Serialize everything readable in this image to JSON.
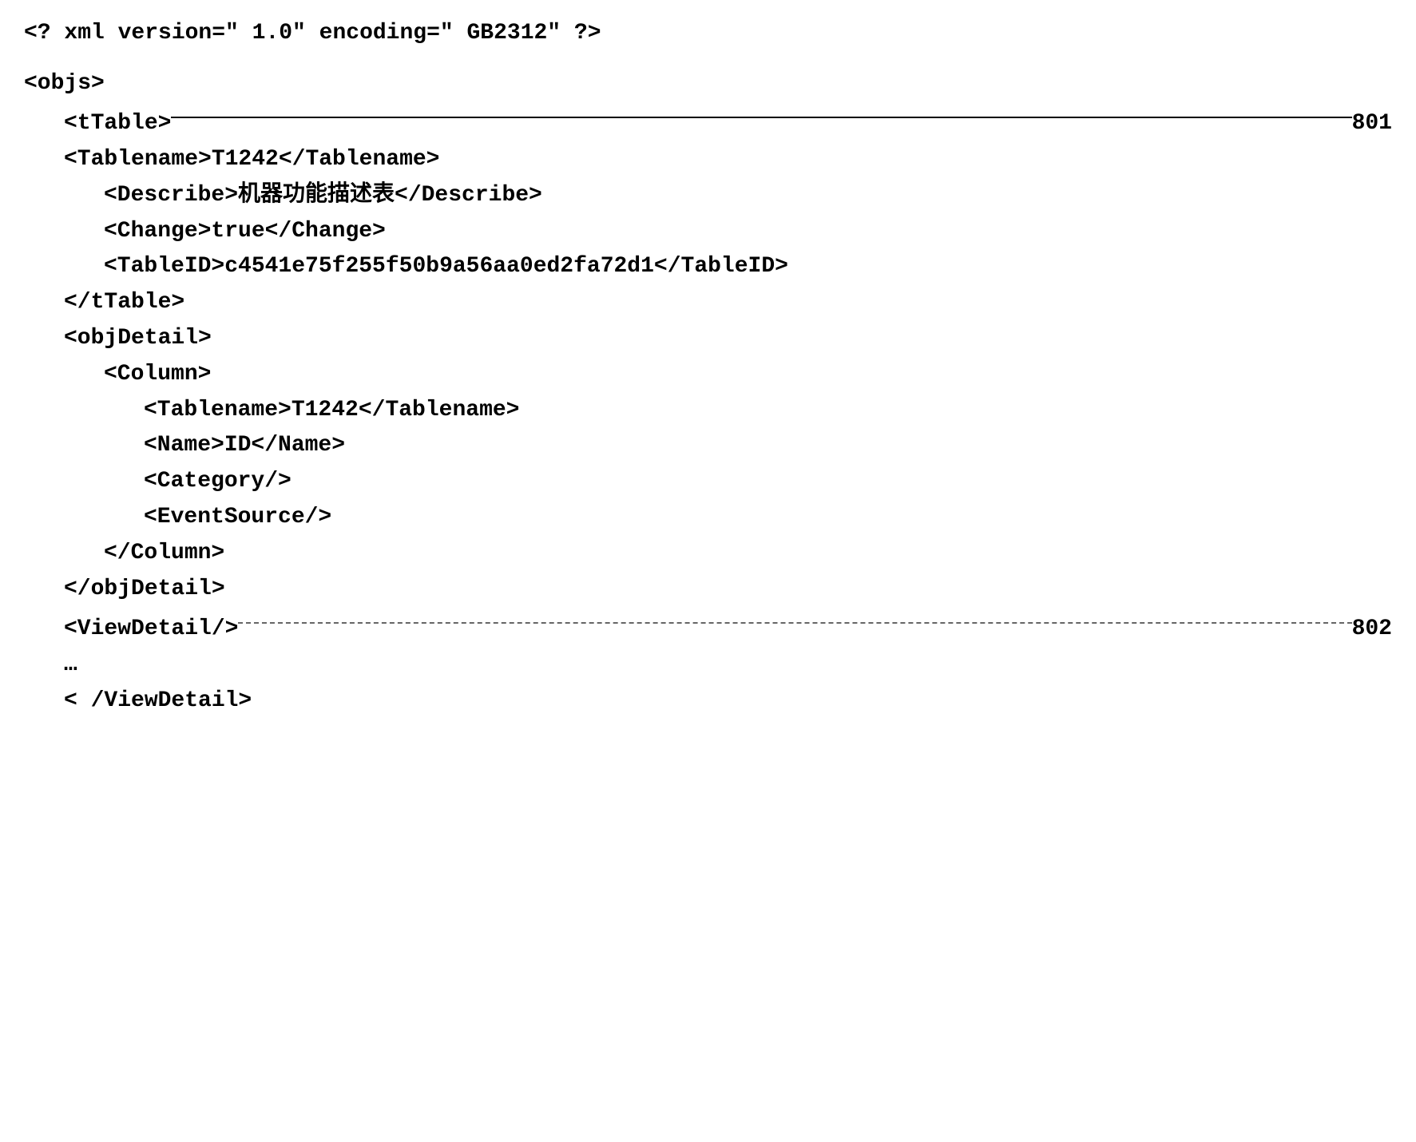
{
  "lines": {
    "l0": "<? xml version=\" 1.0\"  encoding=\" GB2312\" ?>",
    "l1": "<objs>",
    "l2": "<tTable>",
    "l2_label": "801",
    "l3": "<Tablename>T1242</Tablename>",
    "l4": "<Describe>机器功能描述表</Describe>",
    "l5": "<Change>true</Change>",
    "l6": "<TableID>c4541e75f255f50b9a56aa0ed2fa72d1</TableID>",
    "l7": "</tTable>",
    "l8": "<objDetail>",
    "l9": "<Column>",
    "l10": "<Tablename>T1242</Tablename>",
    "l11": "<Name>ID</Name>",
    "l12": "<Category/>",
    "l13": "<EventSource/>",
    "l14": "</Column>",
    "l15": "</objDetail>",
    "l16": "<ViewDetail/>",
    "l16_label": "802",
    "l17": "…",
    "l18": "< /ViewDetail>"
  }
}
